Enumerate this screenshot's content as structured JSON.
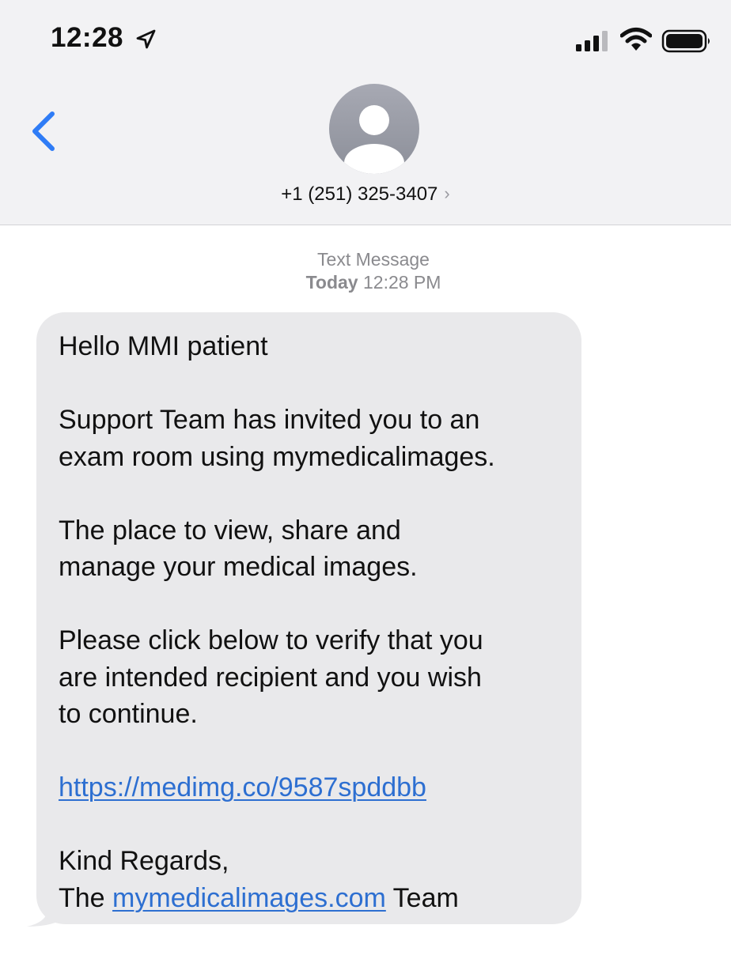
{
  "status_bar": {
    "time": "12:28"
  },
  "header": {
    "contact": "+1 (251) 325-3407",
    "chevron": "›"
  },
  "conversation": {
    "type": "Text Message",
    "day": "Today",
    "time": "12:28 PM"
  },
  "message": {
    "greeting": "Hello MMI patient",
    "para1_line1": "Support Team has invited you to an",
    "para1_line2": "exam room using mymedicalimages.",
    "para2_line1": "The place to view, share and",
    "para2_line2": "manage your medical images.",
    "para3_line1": "Please click below to verify that you",
    "para3_line2": "are intended recipient and you wish",
    "para3_line3": "to continue.",
    "link": "https://medimg.co/9587spddbb",
    "closing": "Kind Regards,",
    "signoff_prefix": "The",
    "signoff_link": "mymedicalimages.com",
    "signoff_suffix": "Team"
  },
  "colors": {
    "header_bg": "#f2f2f4",
    "bubble_bg": "#e9e9eb",
    "link": "#2d6fd1",
    "back_accent": "#2f7cf6",
    "meta_gray": "#8a8a8e"
  }
}
